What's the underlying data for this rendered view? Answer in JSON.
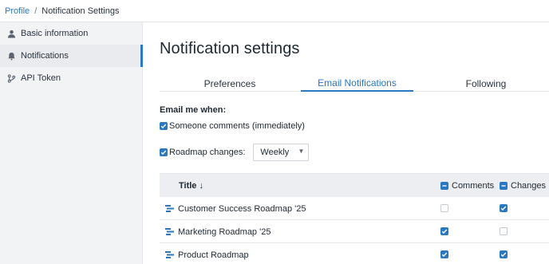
{
  "breadcrumb": {
    "link": "Profile",
    "separator": "/",
    "current": "Notification Settings"
  },
  "sidebar": {
    "items": [
      {
        "label": "Basic information",
        "icon": "user-icon",
        "active": false
      },
      {
        "label": "Notifications",
        "icon": "bell-icon",
        "active": true
      },
      {
        "label": "API Token",
        "icon": "branch-icon",
        "active": false
      }
    ]
  },
  "page": {
    "title": "Notification settings"
  },
  "tabs": [
    {
      "label": "Preferences",
      "active": false
    },
    {
      "label": "Email Notifications",
      "active": true
    },
    {
      "label": "Following",
      "active": false
    }
  ],
  "email": {
    "heading": "Email me when:",
    "someone": {
      "label": "Someone comments (immediately)",
      "checked": true
    },
    "roadmap": {
      "label": "Roadmap changes:",
      "checked": true,
      "frequency": "Weekly"
    }
  },
  "table": {
    "headers": {
      "title": "Title ↓",
      "comments": "Comments",
      "changes": "Changes"
    },
    "rows": [
      {
        "title": "Customer Success Roadmap '25",
        "comments": false,
        "changes": true
      },
      {
        "title": "Marketing Roadmap '25",
        "comments": true,
        "changes": false
      },
      {
        "title": "Product Roadmap",
        "comments": true,
        "changes": true
      }
    ]
  },
  "colors": {
    "accent": "#2a78c2",
    "sidebar_bg": "#f2f3f5",
    "header_bg": "#eceef1"
  }
}
